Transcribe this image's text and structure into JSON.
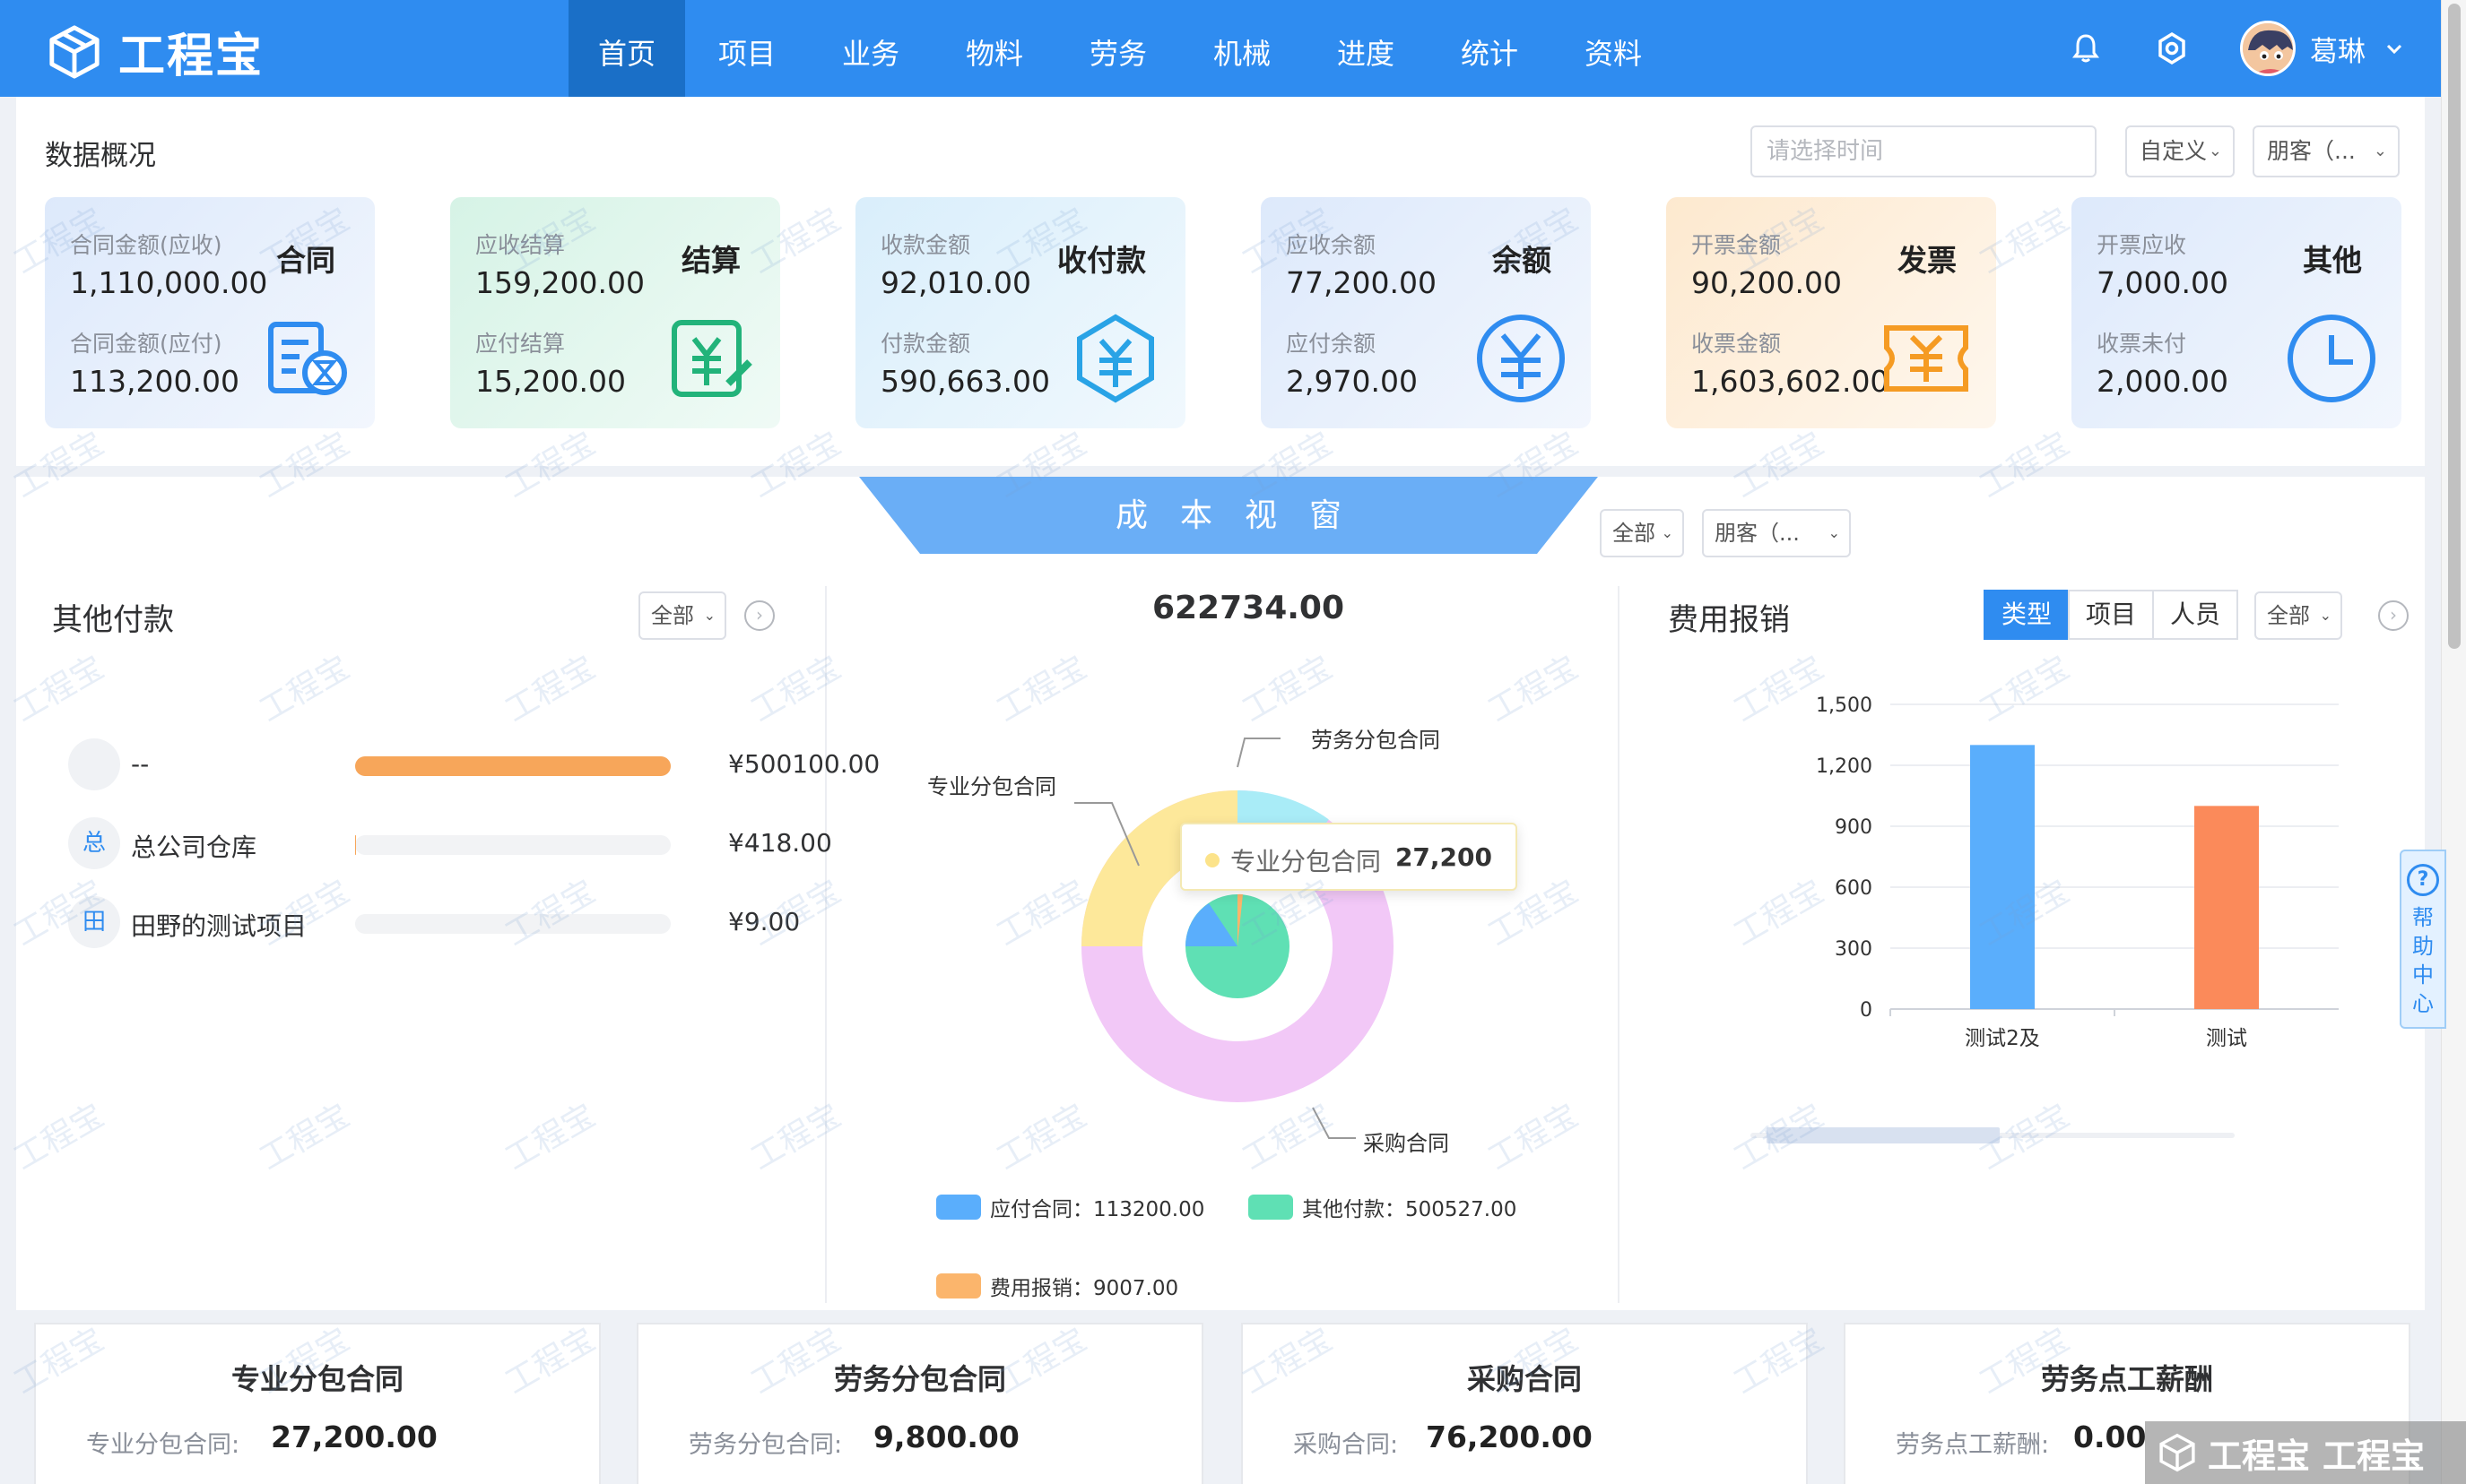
{
  "header": {
    "brand": "工程宝",
    "nav": [
      "首页",
      "项目",
      "业务",
      "物料",
      "劳务",
      "机械",
      "进度",
      "统计",
      "资料"
    ],
    "active_nav": "首页",
    "user_name": "葛琳"
  },
  "overview": {
    "title": "数据概况",
    "time_placeholder": "请选择时间",
    "range_select": "自定义",
    "customer_select": "朋客（...",
    "cards": [
      {
        "title": "合同",
        "label1": "合同金额(应收)",
        "value1": "1,110,000.00",
        "label2": "合同金额(应付)",
        "value2": "113,200.00",
        "icon": "contract-icon",
        "bg": "#dde9fb",
        "color": "#2f8cf0"
      },
      {
        "title": "结算",
        "label1": "应收结算",
        "value1": "159,200.00",
        "label2": "应付结算",
        "value2": "15,200.00",
        "icon": "settlement-icon",
        "bg": "#d6f3e6",
        "color": "#22b37a"
      },
      {
        "title": "收付款",
        "label1": "收款金额",
        "value1": "92,010.00",
        "label2": "付款金额",
        "value2": "590,663.00",
        "icon": "payment-icon",
        "bg": "#d9eefb",
        "color": "#29a3e6"
      },
      {
        "title": "余额",
        "label1": "应收余额",
        "value1": "77,200.00",
        "label2": "应付余额",
        "value2": "2,970.00",
        "icon": "yuan-coin-icon",
        "bg": "#dde9fb",
        "color": "#2f8cf0"
      },
      {
        "title": "发票",
        "label1": "开票金额",
        "value1": "90,200.00",
        "label2": "收票金额",
        "value2": "1,603,602.00",
        "icon": "invoice-icon",
        "bg": "#fde9cf",
        "color": "#f59b23"
      },
      {
        "title": "其他",
        "label1": "开票应收",
        "value1": "7,000.00",
        "label2": "收票未付",
        "value2": "2,000.00",
        "icon": "clock-icon",
        "bg": "#dde9fb",
        "color": "#2f8cf0"
      }
    ]
  },
  "cost_window": {
    "title": "成本视窗",
    "scope_select": "全部",
    "customer_select": "朋客（..."
  },
  "other_payments": {
    "title": "其他付款",
    "filter": "全部",
    "rows": [
      {
        "badge": "",
        "name": "--",
        "amount": "¥500100.00",
        "ratio": 1.0
      },
      {
        "badge": "总",
        "name": "总公司仓库",
        "amount": "¥418.00",
        "ratio": 0.0008
      },
      {
        "badge": "田",
        "name": "田野的测试项目",
        "amount": "¥9.00",
        "ratio": 2e-05
      }
    ]
  },
  "pie": {
    "total": "622734.00",
    "tooltip_name": "专业分包合同",
    "tooltip_value": "27,200",
    "outer_labels": [
      "劳务分包合同",
      "专业分包合同",
      "采购合同"
    ],
    "legend": [
      {
        "name": "应付合同：113200.00",
        "color": "#5aaefc"
      },
      {
        "name": "其他付款：500527.00",
        "color": "#5fe0b4"
      },
      {
        "name": "费用报销：9007.00",
        "color": "#fbb56c"
      }
    ]
  },
  "chart_data": {
    "type": "bar",
    "title": "费用报销",
    "categories": [
      "测试2及",
      "测试"
    ],
    "values": [
      1300,
      1000
    ],
    "colors": [
      "#5aaefc",
      "#fb8a5a"
    ],
    "ylim": [
      0,
      1500
    ],
    "yticks": [
      "0",
      "300",
      "600",
      "900",
      "1,200",
      "1,500"
    ],
    "grid": true
  },
  "expense": {
    "title": "费用报销",
    "tabs": [
      "类型",
      "项目",
      "人员"
    ],
    "active_tab": "类型",
    "filter": "全部"
  },
  "bottom_cards": [
    {
      "title": "专业分包合同",
      "label": "专业分包合同:",
      "value": "27,200.00"
    },
    {
      "title": "劳务分包合同",
      "label": "劳务分包合同:",
      "value": "9,800.00"
    },
    {
      "title": "采购合同",
      "label": "采购合同:",
      "value": "76,200.00"
    },
    {
      "title": "劳务点工薪酬",
      "label": "劳务点工薪酬:",
      "value": "0.00"
    }
  ],
  "help": {
    "label": "帮助中心"
  },
  "watermark": "工程宝"
}
